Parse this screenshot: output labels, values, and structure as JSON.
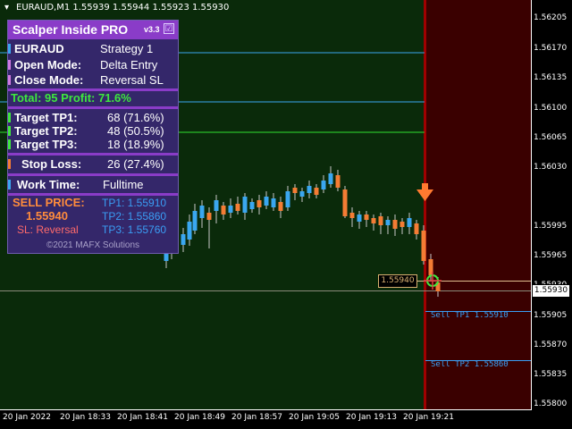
{
  "chart_header": {
    "symbol_line": "EURAUD,M1  1.55939 1.55944 1.55923 1.55930"
  },
  "panel": {
    "title": "Scalper Inside PRO",
    "version": "v3.3",
    "checkbox": "☑",
    "rows": [
      {
        "key": "EURAUD",
        "value": "Strategy 1"
      },
      {
        "key": "Open Mode:",
        "value": "Delta Entry"
      },
      {
        "key": "Close Mode:",
        "value": "Reversal SL"
      }
    ],
    "total_line": "Total: 95  Profit: 71.6%",
    "targets": [
      {
        "key": "Target TP1:",
        "value": "68 (71.6%)"
      },
      {
        "key": "Target TP2:",
        "value": "48 (50.5%)"
      },
      {
        "key": "Target TP3:",
        "value": "18 (18.9%)"
      }
    ],
    "stop_loss": {
      "key": "Stop Loss:",
      "value": "26 (27.4%)"
    },
    "work_time": {
      "key": "Work Time:",
      "value": "Fulltime"
    },
    "sell": {
      "label": "SELL PRICE:",
      "price": "1.55940",
      "sl": "SL: Reversal",
      "tp1": "TP1: 1.55910",
      "tp2": "TP2: 1.55860",
      "tp3": "TP3: 1.55760"
    },
    "copyright": "©2021 MAFX Solutions"
  },
  "price_axis": [
    "1.56205",
    "1.56170",
    "1.56135",
    "1.56100",
    "1.56065",
    "1.56030",
    "1.55995",
    "1.55965",
    "1.55930",
    "1.55905",
    "1.55870",
    "1.55835",
    "1.55800"
  ],
  "time_axis": [
    "20 Jan 2022",
    "20 Jan 18:33",
    "20 Jan 18:41",
    "20 Jan 18:49",
    "20 Jan 18:57",
    "20 Jan 19:05",
    "20 Jan 19:13",
    "20 Jan 19:21"
  ],
  "current_price": "1.55930",
  "entry_price": "1.55940",
  "sell_tp_labels": [
    "Sell TP1 1.55910",
    "Sell TP2 1.55860"
  ],
  "colors": {
    "background": "#000000",
    "session_bg": "#0a2a0a",
    "sell_zone": "#3a0000",
    "bull": "#3aa7f0",
    "bear": "#f47c34",
    "panel_bg": "#34276a",
    "panel_header": "#8a3cc8",
    "profit_green": "#3ee83e",
    "sell_orange": "#ff8c3c",
    "tp_blue": "#3a9ef5"
  }
}
